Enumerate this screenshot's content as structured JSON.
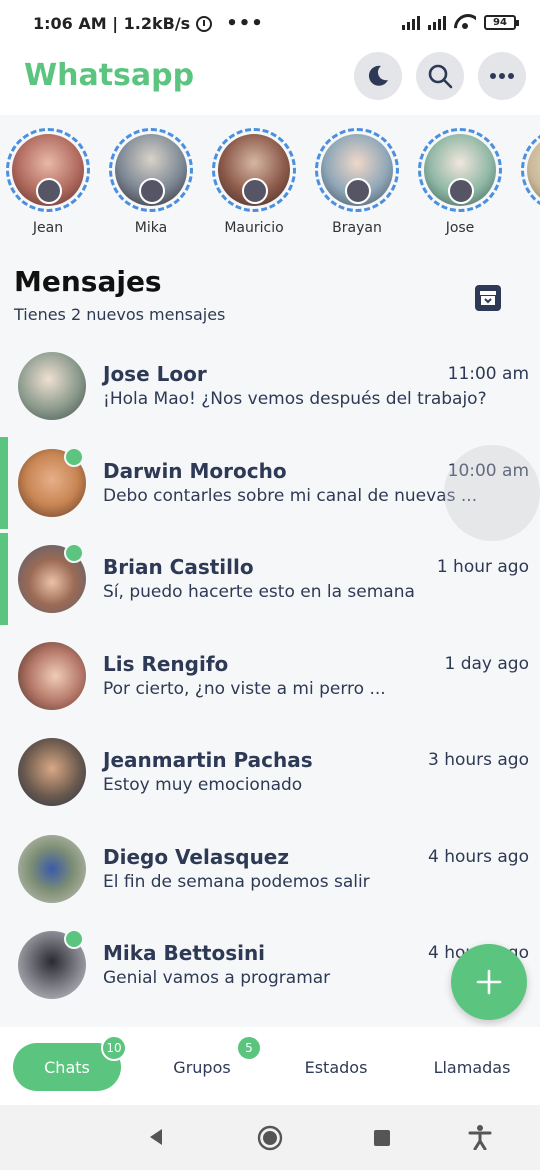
{
  "status_bar": {
    "time_speed": "1:06 AM | 1.2kB/s",
    "more": "•••",
    "battery": "94"
  },
  "header": {
    "title": "Whatsapp",
    "moon_icon": "moon-icon",
    "search_icon": "search-icon",
    "more_icon": "more-icon"
  },
  "stories": [
    {
      "name": "Jean",
      "color": "#b06a5e"
    },
    {
      "name": "Mika",
      "color": "#7b8794"
    },
    {
      "name": "Mauricio",
      "color": "#8c5a4a"
    },
    {
      "name": "Brayan",
      "color": "#8fa7b8"
    },
    {
      "name": "Jose",
      "color": "#8fb7a5"
    },
    {
      "name": "",
      "color": "#c9b896"
    }
  ],
  "messages": {
    "title": "Mensajes",
    "subtitle": "Tienes 2 nuevos mensajes",
    "archive_icon": "archive-icon"
  },
  "chats": [
    {
      "name": "Jose Loor",
      "time": "11:00 am",
      "preview": "¡Hola Mao! ¿Nos vemos después del trabajo?",
      "online": false,
      "unread": false,
      "avatar_color": "#8a9a8c"
    },
    {
      "name": "Darwin Morocho",
      "time": "10:00 am",
      "preview": "Debo contarles sobre mi canal de nuevas ...",
      "online": true,
      "unread": true,
      "avatar_color": "#c98654"
    },
    {
      "name": "Brian Castillo",
      "time": "1 hour ago",
      "preview": "Sí, puedo hacerte esto en la semana",
      "online": true,
      "unread": true,
      "avatar_color": "#4f5f74"
    },
    {
      "name": "Lis Rengifo",
      "time": "1 day ago",
      "preview": "Por cierto, ¿no viste a mi perro ...",
      "online": false,
      "unread": false,
      "avatar_color": "#b77a6a"
    },
    {
      "name": "Jeanmartin Pachas",
      "time": "3 hours ago",
      "preview": "Estoy muy emocionado",
      "online": false,
      "unread": false,
      "avatar_color": "#6b5a4e"
    },
    {
      "name": "Diego Velasquez",
      "time": "4 hours ago",
      "preview": "El fin de semana podemos salir",
      "online": false,
      "unread": false,
      "avatar_color": "#7e8f74"
    },
    {
      "name": "Mika Bettosini",
      "time": "4 hours ago",
      "preview": "Genial vamos a programar",
      "online": true,
      "unread": false,
      "avatar_color": "#7d7d86"
    }
  ],
  "fab_icon": "plus-icon",
  "tabs": {
    "chats": {
      "label": "Chats",
      "badge": "10"
    },
    "grupos": {
      "label": "Grupos",
      "badge": "5"
    },
    "estados": {
      "label": "Estados"
    },
    "llamadas": {
      "label": "Llamadas"
    }
  },
  "system_nav": [
    "back-icon",
    "home-icon",
    "recents-icon",
    "accessibility-icon"
  ],
  "colors": {
    "accent": "#5bc47e",
    "text": "#2e3a55",
    "story_ring": "#4a8fe0"
  }
}
